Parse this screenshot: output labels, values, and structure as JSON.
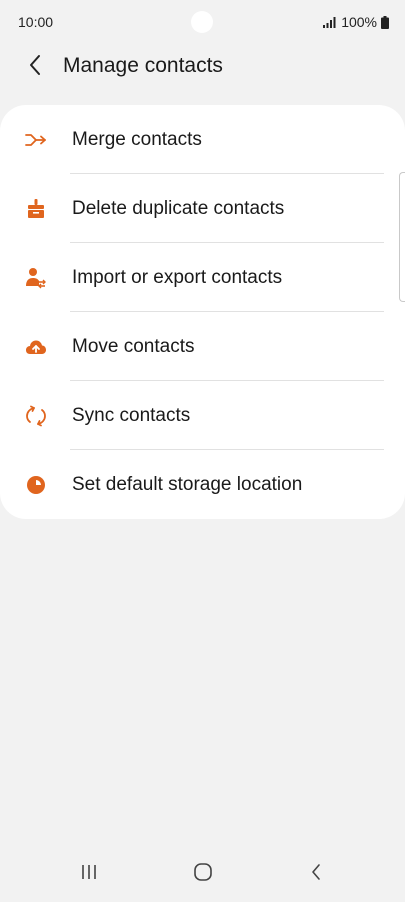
{
  "status_bar": {
    "time": "10:00",
    "battery": "100%"
  },
  "header": {
    "title": "Manage contacts"
  },
  "menu": {
    "items": [
      {
        "label": "Merge contacts",
        "icon": "merge-icon"
      },
      {
        "label": "Delete duplicate contacts",
        "icon": "broom-icon"
      },
      {
        "label": "Import or export contacts",
        "icon": "person-transfer-icon"
      },
      {
        "label": "Move contacts",
        "icon": "cloud-upload-icon"
      },
      {
        "label": "Sync contacts",
        "icon": "sync-icon"
      },
      {
        "label": "Set default storage location",
        "icon": "pie-icon"
      }
    ]
  },
  "colors": {
    "accent": "#e0651e",
    "background": "#f2f2f2",
    "card": "#ffffff"
  }
}
